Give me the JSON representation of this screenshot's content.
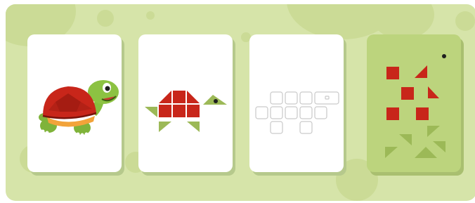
{
  "game": {
    "cards": [
      {
        "id": "picture",
        "kind": "illustration",
        "subject": "turtle-illustration"
      },
      {
        "id": "tangram-solution",
        "kind": "colored-tangram"
      },
      {
        "id": "tangram-outline",
        "kind": "empty-outline"
      },
      {
        "id": "tangram-pieces",
        "kind": "scattered-pieces"
      }
    ],
    "colors": {
      "board": "#d6e4a9",
      "bubbles": "#cbdb96",
      "card_white": "#ffffff",
      "card_green": "#bcd47d",
      "shell_red": "#c8261a",
      "leaf_green": "#9cb957",
      "outline_gray": "#c9c9c9",
      "eye_dark": "#1e1e1e"
    }
  }
}
